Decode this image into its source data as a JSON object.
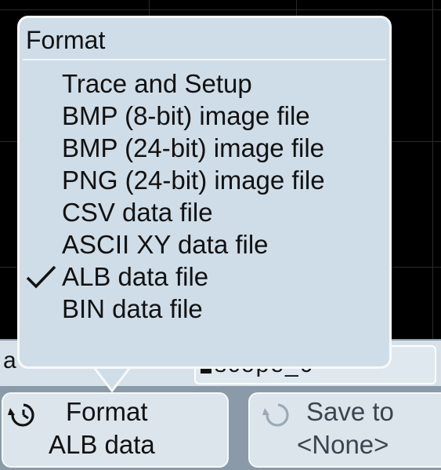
{
  "format_menu": {
    "title": "Format",
    "items": [
      {
        "label": "Trace and Setup",
        "selected": false
      },
      {
        "label": "BMP (8-bit) image file",
        "selected": false
      },
      {
        "label": "BMP (24-bit) image file",
        "selected": false
      },
      {
        "label": "PNG (24-bit) image file",
        "selected": false
      },
      {
        "label": "CSV data file",
        "selected": false
      },
      {
        "label": "ASCII XY data file",
        "selected": false
      },
      {
        "label": "ALB data file",
        "selected": true
      },
      {
        "label": "BIN data file",
        "selected": false
      }
    ]
  },
  "info_strip": {
    "left_text": "a",
    "field_text": "scope_0"
  },
  "softkeys": {
    "format": {
      "label": "Format",
      "value": "ALB data"
    },
    "save_to": {
      "label": "Save to",
      "value": "<None>"
    }
  },
  "colors": {
    "menu_background": "#cfdde8",
    "softkey_background": "#dce5ec",
    "screen_background": "#000000"
  }
}
